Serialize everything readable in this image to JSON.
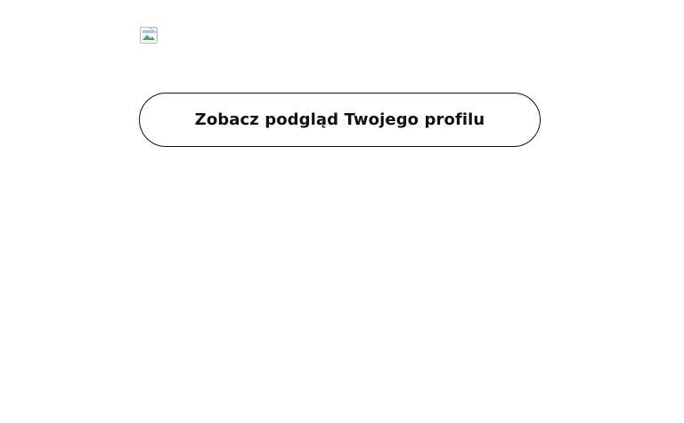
{
  "profile_image": {
    "alt": "",
    "icon": "broken-image-icon"
  },
  "preview_button": {
    "label": "Zobacz podgląd Twojego profilu"
  },
  "colors": {
    "text": "#111111",
    "border": "#111111",
    "background": "#ffffff"
  }
}
